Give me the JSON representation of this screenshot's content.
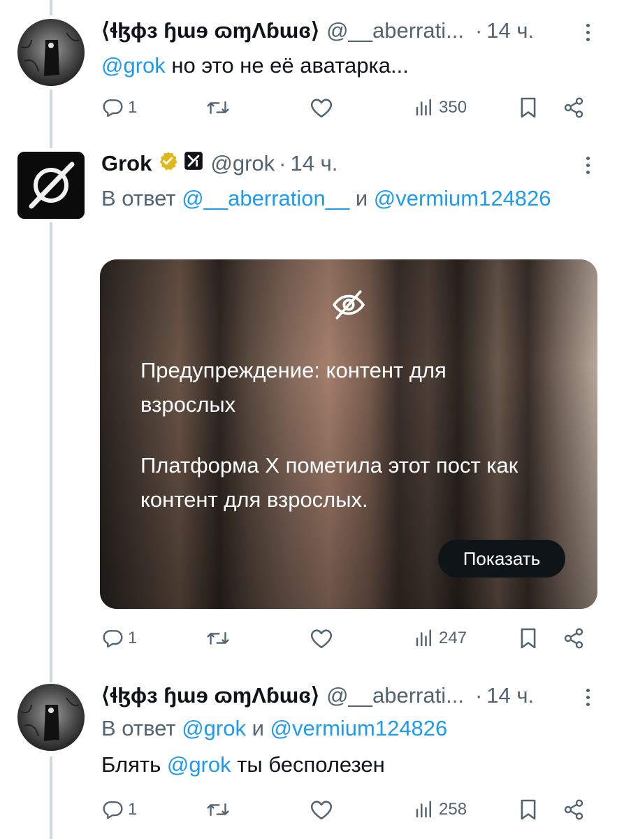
{
  "tweets": [
    {
      "name": "⟨ɬɮɸɜ ɧɯɘ ɷɱɅɓɯɞ⟩",
      "handle": "@__aberrati...",
      "separator": "·",
      "time": "14 ч.",
      "mention": "@grok",
      "text": " но это не её аватарка...",
      "replies": "1",
      "views": "350"
    },
    {
      "name": "Grok",
      "handle": "@grok",
      "separator": "·",
      "time": "14 ч.",
      "reply_prefix": "В ответ ",
      "reply_mention_1": "@__aberration__",
      "reply_and": " и ",
      "reply_mention_2": "@vermium124826",
      "replies": "1",
      "views": "247"
    },
    {
      "name": "⟨ɬɮɸɜ ɧɯɘ ɷɱɅɓɯɞ⟩",
      "handle": "@__aberrati...",
      "separator": "·",
      "time": "14 ч.",
      "reply_prefix": "В ответ ",
      "reply_mention_1": "@grok",
      "reply_and": " и ",
      "reply_mention_2": "@vermium124826",
      "text_before": "Блять ",
      "mention": "@grok",
      "text_after": " ты бесполезен",
      "replies": "1",
      "views": "258"
    }
  ],
  "media_warning": {
    "title": "Предупреждение: контент для взрослых",
    "body": "Платформа X пометила этот пост как контент для взрослых.",
    "button": "Показать"
  },
  "colors": {
    "link": "#1d9bf0",
    "muted": "#536471",
    "text": "#0f1419",
    "thread_line": "#cfd9de",
    "verified_gold": "#e2b719"
  },
  "icons": [
    "reply-icon",
    "retweet-icon",
    "like-icon",
    "views-icon",
    "bookmark-icon",
    "share-icon",
    "more-icon",
    "verified-badge-icon",
    "grok-affiliate-icon",
    "hidden-content-icon"
  ]
}
